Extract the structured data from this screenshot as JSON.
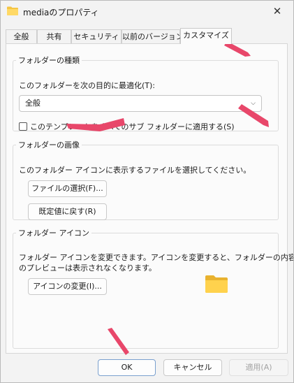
{
  "window": {
    "title": "mediaのプロパティ",
    "close_label": "✕"
  },
  "tabs": [
    {
      "label": "全般"
    },
    {
      "label": "共有"
    },
    {
      "label": "セキュリティ"
    },
    {
      "label": "以前のバージョン"
    },
    {
      "label": "カスタマイズ",
      "active": true
    }
  ],
  "folder_type": {
    "legend": "フォルダーの種類",
    "optimize_label": "このフォルダーを次の目的に最適化(T):",
    "selected_option": "全般",
    "apply_subfolders_label": "このテンプレートをすべてのサブ フォルダーに適用する(S)",
    "apply_subfolders_checked": false
  },
  "folder_picture": {
    "legend": "フォルダーの画像",
    "description": "このフォルダー アイコンに表示するファイルを選択してください。",
    "choose_file_label": "ファイルの選択(F)...",
    "restore_default_label": "既定値に戻す(R)"
  },
  "folder_icon": {
    "legend": "フォルダー アイコン",
    "description_line1": "フォルダー アイコンを変更できます。アイコンを変更すると、フォルダーの内容",
    "description_line2": "のプレビューは表示されなくなります。",
    "change_icon_label": "アイコンの変更(I)..."
  },
  "footer": {
    "ok_label": "OK",
    "cancel_label": "キャンセル",
    "apply_label": "適用(A)"
  },
  "colors": {
    "annotation_arrow": "#e8476a",
    "folder_yellow": "#f5c542",
    "accent": "#0067c0"
  }
}
